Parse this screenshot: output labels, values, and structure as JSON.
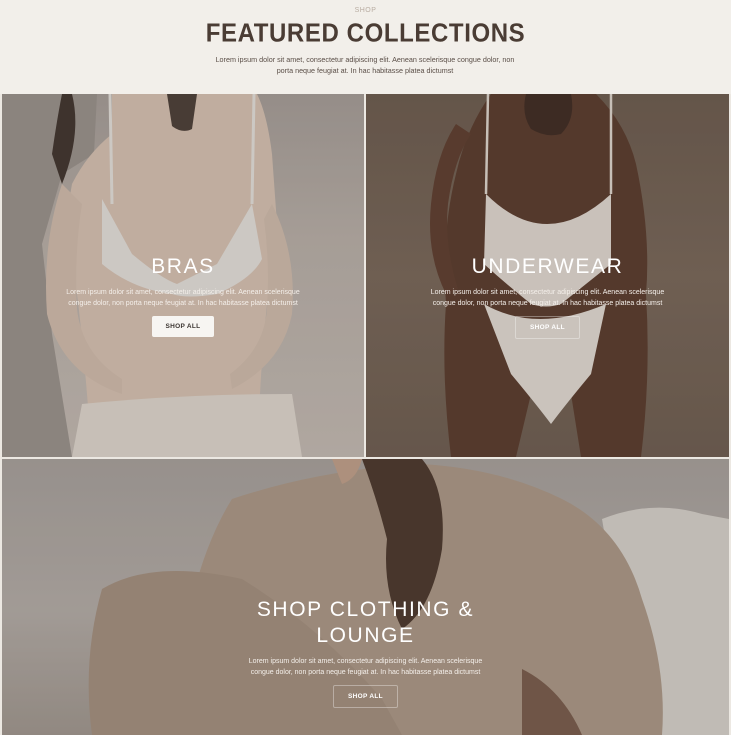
{
  "header": {
    "eyebrow": "SHOP",
    "title": "FEATURED COLLECTIONS",
    "subtitle": "Lorem ipsum dolor sit amet, consectetur adipiscing elit. Aenean scelerisque congue dolor, non porta neque feugiat at. In hac habitasse platea dictumst"
  },
  "collections": [
    {
      "title": "BRAS",
      "description": "Lorem ipsum dolor sit amet, consectetur adipiscing elit. Aenean scelerisque congue dolor, non porta neque feugiat at. In hac habitasse platea dictumst",
      "button": "SHOP ALL"
    },
    {
      "title": "UNDERWEAR",
      "description": "Lorem ipsum dolor sit amet, consectetur adipiscing elit. Aenean scelerisque congue dolor, non porta neque feugiat at. In hac habitasse platea dictumst",
      "button": "SHOP ALL"
    },
    {
      "title": "SHOP CLOTHING & LOUNGE",
      "description": "Lorem ipsum dolor sit amet, consectetur adipiscing elit. Aenean scelerisque congue dolor, non porta neque feugiat at. In hac habitasse platea dictumst",
      "button": "SHOP ALL"
    }
  ]
}
